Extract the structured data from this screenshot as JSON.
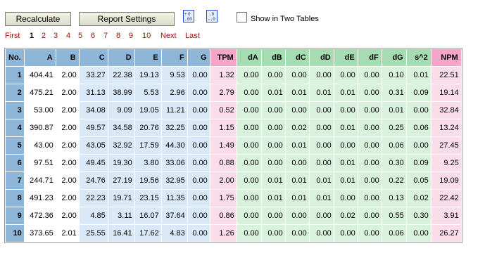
{
  "toolbar": {
    "recalculate_label": "Recalculate",
    "settings_label": "Report Settings",
    "increase_decimals_icon": "increase-decimals-icon",
    "decrease_decimals_icon": "decrease-decimals-icon",
    "two_tables_label": "Show in Two Tables",
    "two_tables_checked": false
  },
  "pager": {
    "first": "First",
    "pages": [
      "1",
      "2",
      "3",
      "4",
      "5",
      "6",
      "7",
      "8",
      "9",
      "10"
    ],
    "current": "1",
    "next": "Next",
    "last": "Last"
  },
  "colors": {
    "header_blue": "#8db6d9",
    "cell_blue": "#d9e9f7",
    "header_pink": "#f4a6c9",
    "cell_pink": "#fbdce9",
    "header_green": "#a6dcb1",
    "cell_green": "#d9f2de",
    "link_red": "#a01010"
  },
  "table": {
    "headers": [
      "No.",
      "A",
      "B",
      "C",
      "D",
      "E",
      "F",
      "G",
      "TPM",
      "dA",
      "dB",
      "dC",
      "dD",
      "dE",
      "dF",
      "dG",
      "s^2",
      "NPM"
    ],
    "rows": [
      [
        "1",
        "404.41",
        "2.00",
        "33.27",
        "22.38",
        "19.13",
        "9.53",
        "0.00",
        "1.32",
        "0.00",
        "0.00",
        "0.00",
        "0.00",
        "0.00",
        "0.00",
        "0.10",
        "0.01",
        "22.51"
      ],
      [
        "2",
        "475.21",
        "2.00",
        "31.13",
        "38.99",
        "5.53",
        "2.96",
        "0.00",
        "2.79",
        "0.00",
        "0.01",
        "0.01",
        "0.01",
        "0.01",
        "0.00",
        "0.31",
        "0.09",
        "19.14"
      ],
      [
        "3",
        "53.00",
        "2.00",
        "34.08",
        "9.09",
        "19.05",
        "11.21",
        "0.00",
        "0.52",
        "0.00",
        "0.00",
        "0.00",
        "0.00",
        "0.00",
        "0.00",
        "0.01",
        "0.00",
        "32.84"
      ],
      [
        "4",
        "390.87",
        "2.00",
        "49.57",
        "34.58",
        "20.76",
        "32.25",
        "0.00",
        "1.15",
        "0.00",
        "0.00",
        "0.02",
        "0.00",
        "0.01",
        "0.00",
        "0.25",
        "0.06",
        "13.24"
      ],
      [
        "5",
        "43.00",
        "2.00",
        "43.05",
        "32.92",
        "17.59",
        "44.30",
        "0.00",
        "1.49",
        "0.00",
        "0.00",
        "0.01",
        "0.00",
        "0.00",
        "0.00",
        "0.06",
        "0.00",
        "27.45"
      ],
      [
        "6",
        "97.51",
        "2.00",
        "49.45",
        "19.30",
        "3.80",
        "33.06",
        "0.00",
        "0.88",
        "0.00",
        "0.00",
        "0.00",
        "0.00",
        "0.01",
        "0.00",
        "0.30",
        "0.09",
        "9.25"
      ],
      [
        "7",
        "244.71",
        "2.00",
        "24.76",
        "27.19",
        "19.56",
        "32.95",
        "0.00",
        "2.00",
        "0.00",
        "0.01",
        "0.01",
        "0.01",
        "0.01",
        "0.00",
        "0.22",
        "0.05",
        "19.09"
      ],
      [
        "8",
        "491.23",
        "2.00",
        "22.23",
        "19.71",
        "23.15",
        "11.35",
        "0.00",
        "1.75",
        "0.00",
        "0.01",
        "0.01",
        "0.01",
        "0.00",
        "0.00",
        "0.13",
        "0.02",
        "22.42"
      ],
      [
        "9",
        "472.36",
        "2.00",
        "4.85",
        "3.11",
        "16.07",
        "37.64",
        "0.00",
        "0.86",
        "0.00",
        "0.00",
        "0.00",
        "0.00",
        "0.02",
        "0.00",
        "0.55",
        "0.30",
        "3.91"
      ],
      [
        "10",
        "373.65",
        "2.01",
        "25.55",
        "16.41",
        "17.62",
        "4.83",
        "0.00",
        "1.26",
        "0.00",
        "0.00",
        "0.00",
        "0.00",
        "0.00",
        "0.00",
        "0.06",
        "0.00",
        "26.27"
      ]
    ]
  }
}
